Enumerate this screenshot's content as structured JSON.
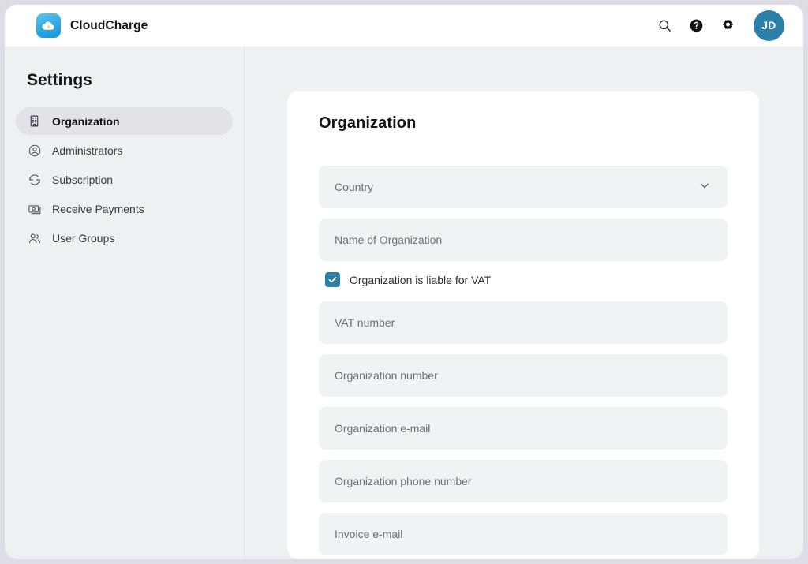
{
  "brand": {
    "name": "CloudCharge",
    "logo_icon": "cloud-lightning-icon",
    "accent": "#2ea8e0"
  },
  "header": {
    "search_icon": "search-icon",
    "help_icon": "help-circle-icon",
    "settings_icon": "gear-icon",
    "avatar_initials": "JD",
    "avatar_color": "#2c7fa6"
  },
  "sidebar": {
    "title": "Settings",
    "items": [
      {
        "label": "Organization",
        "icon": "building-icon",
        "active": true
      },
      {
        "label": "Administrators",
        "icon": "user-circle-icon",
        "active": false
      },
      {
        "label": "Subscription",
        "icon": "refresh-cycle-icon",
        "active": false
      },
      {
        "label": "Receive Payments",
        "icon": "banknote-icon",
        "active": false
      },
      {
        "label": "User Groups",
        "icon": "users-icon",
        "active": false
      }
    ]
  },
  "main": {
    "title": "Organization",
    "country": {
      "placeholder": "Country",
      "value": "",
      "chevron_icon": "chevron-down-icon"
    },
    "org_name": {
      "placeholder": "Name of Organization",
      "value": ""
    },
    "vat_checkbox": {
      "label": "Organization is liable for VAT",
      "checked": true,
      "color": "#2c7fa6"
    },
    "vat_number": {
      "placeholder": "VAT number",
      "value": ""
    },
    "org_number": {
      "placeholder": "Organization number",
      "value": ""
    },
    "org_email": {
      "placeholder": "Organization e-mail",
      "value": ""
    },
    "org_phone": {
      "placeholder": "Organization phone number",
      "value": ""
    },
    "invoice_email": {
      "placeholder": "Invoice e-mail",
      "value": ""
    }
  }
}
